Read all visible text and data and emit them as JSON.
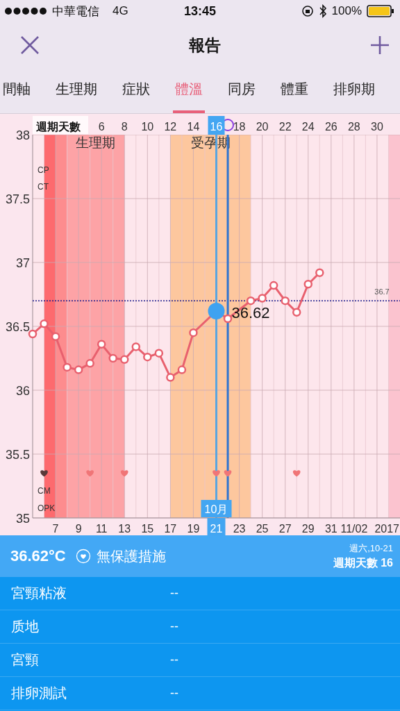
{
  "status_bar": {
    "carrier": "中華電信",
    "network": "4G",
    "time": "13:45",
    "battery": "100%"
  },
  "nav": {
    "title": "報告"
  },
  "tabs": [
    {
      "label": "間軸",
      "selected": false
    },
    {
      "label": "生理期",
      "selected": false
    },
    {
      "label": "症狀",
      "selected": false
    },
    {
      "label": "體溫",
      "selected": true
    },
    {
      "label": "同房",
      "selected": false
    },
    {
      "label": "體重",
      "selected": false
    },
    {
      "label": "排卵期",
      "selected": false
    }
  ],
  "chart": {
    "side_labels_top": [
      "CP",
      "CT"
    ],
    "side_labels_bottom": [
      "CM",
      "OPK"
    ],
    "month_badge": "10月",
    "date_axis": [
      {
        "label": "7",
        "selected": false
      },
      {
        "label": "9",
        "selected": false
      },
      {
        "label": "11",
        "selected": false
      },
      {
        "label": "13",
        "selected": false
      },
      {
        "label": "15",
        "selected": false
      },
      {
        "label": "17",
        "selected": false
      },
      {
        "label": "19",
        "selected": false
      },
      {
        "label": "21",
        "selected": true
      },
      {
        "label": "23",
        "selected": false
      },
      {
        "label": "25",
        "selected": false
      },
      {
        "label": "27",
        "selected": false
      },
      {
        "label": "29",
        "selected": false
      },
      {
        "label": "31",
        "selected": false
      },
      {
        "label": "11/02",
        "selected": false
      },
      {
        "label": "2017",
        "selected": false
      }
    ],
    "chart_data": {
      "type": "line",
      "xlabel": "週期天數",
      "xlim": [
        0,
        32
      ],
      "ylim": [
        35,
        38
      ],
      "grid": true,
      "x": [
        0,
        1,
        2,
        3,
        4,
        5,
        6,
        7,
        8,
        9,
        10,
        11,
        12,
        13,
        14,
        16,
        17,
        19,
        20,
        21,
        22,
        23,
        24,
        25
      ],
      "series": [
        {
          "color": "#e8606e",
          "marker": "circle",
          "values": [
            36.44,
            36.52,
            36.42,
            36.18,
            36.16,
            36.21,
            36.36,
            36.25,
            36.24,
            36.34,
            36.26,
            36.29,
            36.1,
            36.16,
            36.45,
            36.62,
            36.56,
            36.7,
            36.72,
            36.82,
            36.7,
            36.61,
            36.83,
            36.92
          ]
        },
        {
          "type": "scatter",
          "color": "#5a3a3a",
          "values": [
            null,
            35.35,
            null,
            null,
            null,
            null,
            null,
            null,
            null,
            null,
            null,
            null,
            null,
            null,
            null,
            null,
            null,
            null,
            null,
            null,
            null,
            null,
            null,
            null
          ]
        },
        {
          "type": "scatter",
          "color": "#f07577",
          "values": [
            null,
            null,
            null,
            null,
            null,
            35.35,
            null,
            null,
            35.35,
            null,
            null,
            null,
            null,
            null,
            null,
            35.35,
            35.35,
            null,
            null,
            null,
            null,
            35.35,
            null,
            null
          ]
        }
      ],
      "xticks": [
        {
          "value": 6,
          "label": "6"
        },
        {
          "value": 8,
          "label": "8"
        },
        {
          "value": 10,
          "label": "10"
        },
        {
          "value": 12,
          "label": "12"
        },
        {
          "value": 14,
          "label": "14"
        },
        {
          "value": 16,
          "label": "16"
        },
        {
          "value": 18,
          "label": "18"
        },
        {
          "value": 20,
          "label": "20"
        },
        {
          "value": 22,
          "label": "22"
        },
        {
          "value": 24,
          "label": "24"
        },
        {
          "value": 26,
          "label": "26"
        },
        {
          "value": 28,
          "label": "28"
        },
        {
          "value": 30,
          "label": "30"
        }
      ],
      "yticks": [
        {
          "value": 35,
          "label": "35"
        },
        {
          "value": 35.5,
          "label": "35.5"
        },
        {
          "value": 36,
          "label": "36"
        },
        {
          "value": 36.5,
          "label": "36.5"
        },
        {
          "value": 37,
          "label": "37"
        },
        {
          "value": 37.5,
          "label": "37.5"
        },
        {
          "value": 38,
          "label": "38"
        }
      ],
      "bands": [
        {
          "axis": "x",
          "from": 1,
          "to": 2,
          "color": "#fd6a6e"
        },
        {
          "axis": "x",
          "from": 2,
          "to": 3,
          "color": "#fd8c8e"
        },
        {
          "axis": "x",
          "from": 3,
          "to": 8,
          "color": "#fda3a6",
          "label": "生理期"
        },
        {
          "axis": "x",
          "from": 12,
          "to": 19,
          "color": "#fdc79e",
          "label": "受孕期"
        },
        {
          "axis": "x",
          "from": 31,
          "to": 32,
          "color": "#fbc3cf"
        }
      ],
      "ref_lines": [
        {
          "axis": "y",
          "value": 36.7,
          "label": "36.7"
        },
        {
          "axis": "x",
          "value": 16,
          "color": "#5aa5e0"
        },
        {
          "axis": "x",
          "value": 17,
          "color": "#2f73d0"
        }
      ],
      "annotations": [
        {
          "x": 16,
          "y": 36.62,
          "text": "36.62"
        }
      ]
    }
  },
  "summary": {
    "temperature": "36.62°C",
    "protection": "無保護措施",
    "date": "週六,10-21",
    "cycle_day": "週期天數 16"
  },
  "details": [
    {
      "label": "宮頸粘液",
      "value": "--"
    },
    {
      "label": "质地",
      "value": "--"
    },
    {
      "label": "宮頸",
      "value": "--"
    },
    {
      "label": "排卵測試",
      "value": "--"
    }
  ]
}
